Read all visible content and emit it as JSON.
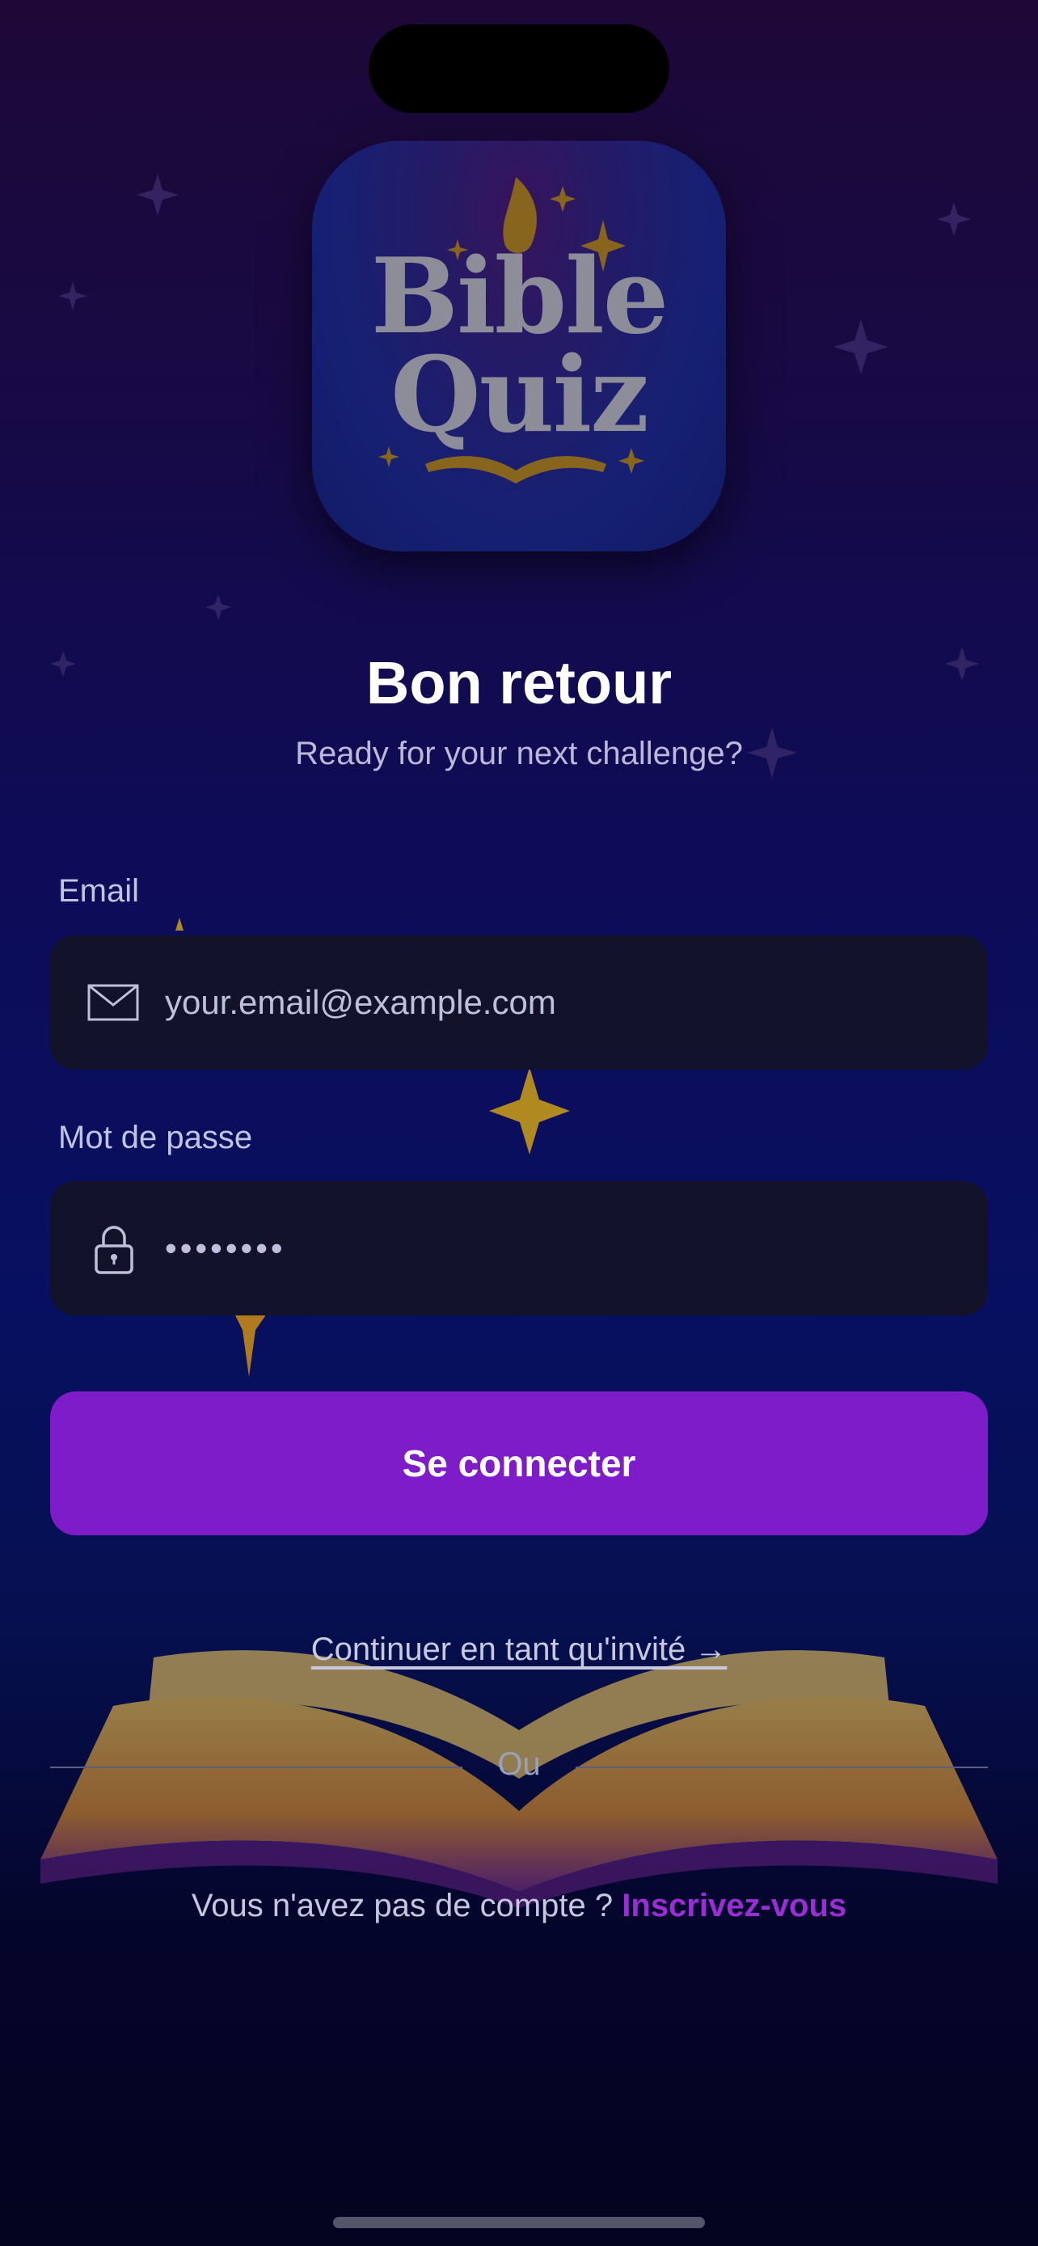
{
  "app": {
    "logo_line1": "Bible",
    "logo_line2": "Quiz"
  },
  "header": {
    "title": "Bon retour",
    "subtitle": "Ready for your next challenge?"
  },
  "form": {
    "email_label": "Email",
    "email_placeholder": "your.email@example.com",
    "password_label": "Mot de passe",
    "password_value": "••••••••"
  },
  "actions": {
    "login_label": "Se connecter",
    "guest_label": "Continuer en tant qu'invité →",
    "or_label": "Ou",
    "no_account_text": "Vous n'avez pas de compte ?",
    "signup_label": "Inscrivez-vous"
  },
  "colors": {
    "accent": "#7e1cc9",
    "link": "#9a2ed4",
    "gold": "#d7a12b",
    "field_bg": "#12122a"
  },
  "icons": {
    "email": "mail-icon",
    "password": "lock-icon"
  }
}
